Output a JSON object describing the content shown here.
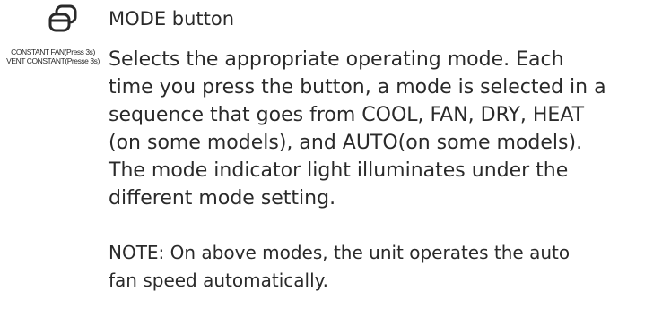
{
  "icon": {
    "name": "mode-icon"
  },
  "icon_caption": {
    "line1": "CONSTANT FAN(Press 3s)",
    "line2": "VENT CONSTANT(Presse 3s)"
  },
  "title": "MODE button",
  "description_lines": [
    "Selects the appropriate operating mode.  Each",
    "time you press the button, a mode is selected in a",
    "sequence that goes from COOL, FAN, DRY, HEAT",
    "(on some models), and AUTO(on some models).",
    "The mode indicator light illuminates under the",
    "different mode setting."
  ],
  "note_lines": [
    "NOTE: On above modes, the unit operates  the auto",
    "fan speed automatically."
  ]
}
